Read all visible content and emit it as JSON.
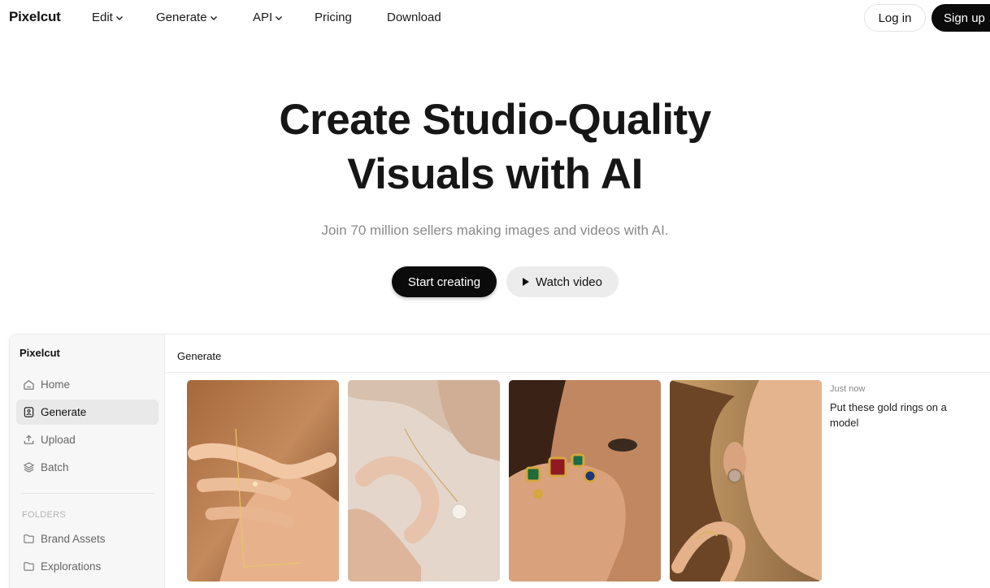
{
  "nav": {
    "logo": "Pixelcut",
    "items": [
      {
        "label": "Edit",
        "has_menu": true
      },
      {
        "label": "Generate",
        "has_menu": true
      },
      {
        "label": "API",
        "has_menu": true
      },
      {
        "label": "Pricing",
        "has_menu": false
      },
      {
        "label": "Download",
        "has_menu": false
      }
    ],
    "login_label": "Log in",
    "signup_label": "Sign up"
  },
  "hero": {
    "title_line1": "Create Studio-Quality",
    "title_line2": "Visuals with AI",
    "subtitle": "Join 70 million sellers making images and videos with AI.",
    "primary_cta": "Start creating",
    "secondary_cta": "Watch video"
  },
  "app": {
    "sidebar": {
      "title": "Pixelcut",
      "items": [
        {
          "label": "Home",
          "icon": "home-icon",
          "active": false
        },
        {
          "label": "Generate",
          "icon": "image-icon",
          "active": true
        },
        {
          "label": "Upload",
          "icon": "upload-icon",
          "active": false
        },
        {
          "label": "Batch",
          "icon": "layers-icon",
          "active": false
        }
      ],
      "folders_heading": "FOLDERS",
      "folders": [
        {
          "label": "Brand Assets",
          "icon": "folder-icon"
        },
        {
          "label": "Explorations",
          "icon": "folder-icon"
        }
      ]
    },
    "main": {
      "title": "Generate",
      "images": [
        {
          "alt": "hand with gold chain ring"
        },
        {
          "alt": "pearl pendant necklace"
        },
        {
          "alt": "hand with gemstone rings"
        },
        {
          "alt": "gold earring and rings"
        }
      ],
      "result_time": "Just now",
      "result_prompt": "Put these gold rings on a model"
    }
  },
  "colors": {
    "primary_button": "#0b0b0b",
    "secondary_button": "#ececec",
    "subtitle": "#8a8a8a",
    "sidebar_bg": "#f7f7f7"
  }
}
